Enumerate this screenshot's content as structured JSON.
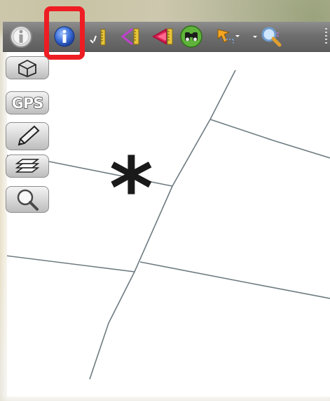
{
  "toolbar": {
    "items": [
      {
        "name": "identify-features",
        "icon": "info-i-gray-icon"
      },
      {
        "name": "identify-info",
        "icon": "info-i-blue-icon",
        "highlighted": true
      },
      {
        "name": "measure-line",
        "icon": "ruler-icon"
      },
      {
        "name": "measure-area",
        "icon": "angle-measure-icon"
      },
      {
        "name": "measure-angle",
        "icon": "angle-measure-red-icon"
      },
      {
        "name": "map-tips",
        "icon": "binoculars-icon"
      },
      {
        "name": "select-features",
        "icon": "select-cursor-icon"
      },
      {
        "name": "zoom-to",
        "icon": "magnifier-icon"
      }
    ]
  },
  "left_panel": {
    "items": [
      {
        "name": "3d-view",
        "icon": "cube-icon"
      },
      {
        "name": "gps",
        "label": "GPS"
      },
      {
        "name": "digitize",
        "icon": "pencil-icon"
      },
      {
        "name": "layers",
        "icon": "layers-icon"
      },
      {
        "name": "search",
        "icon": "magnifier-icon"
      }
    ]
  },
  "annotation": {
    "asterisk": "*",
    "highlight_color": "#ee1d23"
  },
  "colors": {
    "map_line": "#6d7b80",
    "toolbar": "#6f6f6f"
  }
}
